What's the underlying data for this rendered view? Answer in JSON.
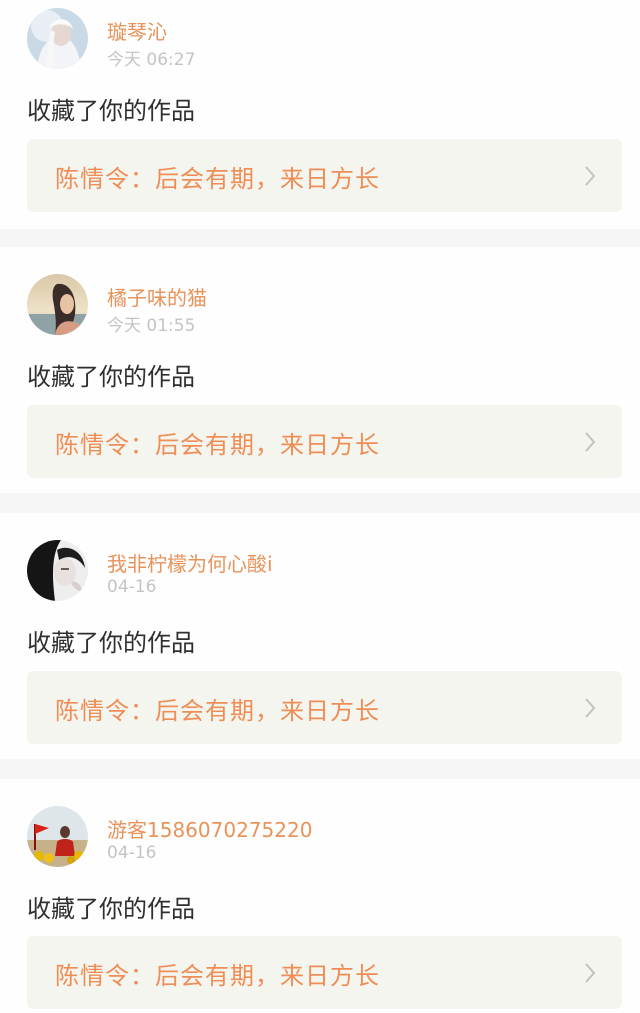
{
  "colors": {
    "accent": "#ee8e56",
    "name": "#e8935a",
    "time": "#c4c4c4",
    "text": "#2f2f2f",
    "work_bg": "#f5f5ef",
    "separator": "#f6f6f6"
  },
  "notifications": [
    {
      "user": "璇琴沁",
      "time": "今天 06:27",
      "action": "收藏了你的作品",
      "work": "陈情令：后会有期，来日方长",
      "avatar_icon": "avatar-white-hair-icon"
    },
    {
      "user": "橘子味的猫",
      "time": "今天 01:55",
      "action": "收藏了你的作品",
      "work": "陈情令：后会有期，来日方长",
      "avatar_icon": "avatar-sunset-girl-icon"
    },
    {
      "user": "我非柠檬为何心酸i",
      "time": "04-16",
      "action": "收藏了你的作品",
      "work": "陈情令：后会有期，来日方长",
      "avatar_icon": "avatar-dark-hair-icon"
    },
    {
      "user": "游客1586070275220",
      "time": "04-16",
      "action": "收藏了你的作品",
      "work": "陈情令：后会有期，来日方长",
      "avatar_icon": "avatar-flag-icon"
    }
  ]
}
